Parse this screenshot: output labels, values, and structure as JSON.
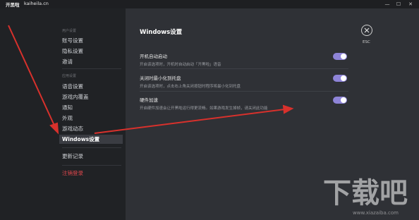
{
  "titlebar": {
    "app_name": "开黑啦",
    "site": "kaiheila.cn",
    "minimize_glyph": "—",
    "maximize_glyph": "☐",
    "close_glyph": "✕"
  },
  "sidebar": {
    "group_user": "用户设置",
    "user_items": [
      "账号设置",
      "隐私设置",
      "邀请"
    ],
    "group_app": "应用设置",
    "app_items": [
      "语音设置",
      "游戏内覆盖",
      "通知",
      "外观",
      "游戏动态",
      "Windows设置"
    ],
    "active_item": "Windows设置",
    "changelog": "更新记录",
    "logout": "注销登录"
  },
  "main": {
    "title": "Windows设置",
    "esc_label": "ESC",
    "settings": [
      {
        "name": "开机自动启动",
        "desc": "开启该选项时，开机时自动启动「开黑啦」语音",
        "enabled": true
      },
      {
        "name": "关闭时最小化到托盘",
        "desc": "开启该选项时，点击右上角关闭按钮时程序将最小化到托盘",
        "enabled": true
      },
      {
        "name": "硬件加速",
        "desc": "开启硬件加速会让开黑啦运行得更流畅。如果游戏发生掉帧，请关闭此功能",
        "enabled": true
      }
    ]
  },
  "watermark": {
    "logo_text": "下载吧",
    "url": "www.xiazaiba.com"
  },
  "colors": {
    "toggle_on": "#8e84d8",
    "annotation_arrow": "#d8312c",
    "logout": "#e0474c"
  }
}
